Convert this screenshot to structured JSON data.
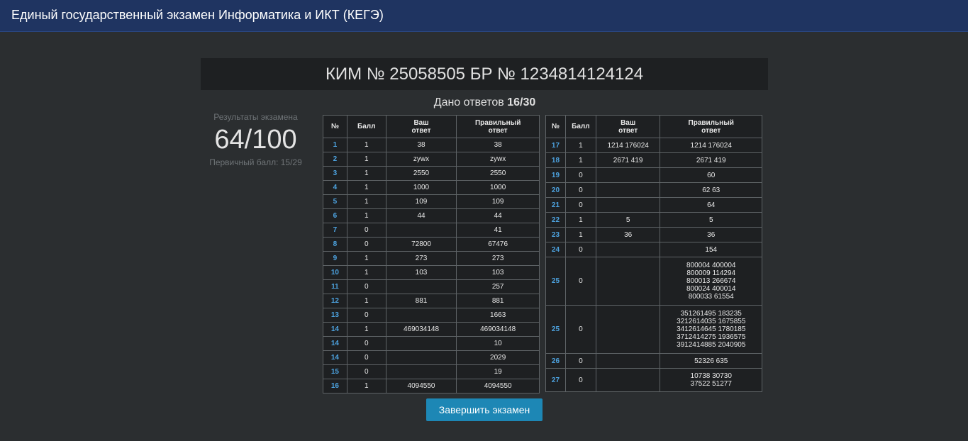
{
  "app": {
    "title": "Единый государственный экзамен Информатика и ИКТ (КЕГЭ)"
  },
  "header": {
    "kim_line": "КИМ № 25058505 БР № 1234814124124"
  },
  "answers_given": {
    "label": "Дано ответов",
    "value": "16/30"
  },
  "results": {
    "label": "Результаты экзамена",
    "score": "64/100",
    "primary": "Первичный балл: 15/29"
  },
  "table_headers": {
    "num": "№",
    "points": "Балл",
    "your_answer": "Ваш\nответ",
    "correct_answer": "Правильный\nответ"
  },
  "left_rows": [
    {
      "num": "1",
      "points": "1",
      "answer": "38",
      "correct": "38"
    },
    {
      "num": "2",
      "points": "1",
      "answer": "zywx",
      "correct": "zywx"
    },
    {
      "num": "3",
      "points": "1",
      "answer": "2550",
      "correct": "2550"
    },
    {
      "num": "4",
      "points": "1",
      "answer": "1000",
      "correct": "1000"
    },
    {
      "num": "5",
      "points": "1",
      "answer": "109",
      "correct": "109"
    },
    {
      "num": "6",
      "points": "1",
      "answer": "44",
      "correct": "44"
    },
    {
      "num": "7",
      "points": "0",
      "answer": "",
      "correct": "41"
    },
    {
      "num": "8",
      "points": "0",
      "answer": "72800",
      "correct": "67476"
    },
    {
      "num": "9",
      "points": "1",
      "answer": "273",
      "correct": "273"
    },
    {
      "num": "10",
      "points": "1",
      "answer": "103",
      "correct": "103"
    },
    {
      "num": "11",
      "points": "0",
      "answer": "",
      "correct": "257"
    },
    {
      "num": "12",
      "points": "1",
      "answer": "881",
      "correct": "881"
    },
    {
      "num": "13",
      "points": "0",
      "answer": "",
      "correct": "1663"
    },
    {
      "num": "14",
      "points": "1",
      "answer": "469034148",
      "correct": "469034148"
    },
    {
      "num": "14",
      "points": "0",
      "answer": "",
      "correct": "10"
    },
    {
      "num": "14",
      "points": "0",
      "answer": "",
      "correct": "2029"
    },
    {
      "num": "15",
      "points": "0",
      "answer": "",
      "correct": "19"
    },
    {
      "num": "16",
      "points": "1",
      "answer": "4094550",
      "correct": "4094550"
    }
  ],
  "right_rows": [
    {
      "num": "17",
      "points": "1",
      "answer": "1214 176024",
      "correct": "1214 176024"
    },
    {
      "num": "18",
      "points": "1",
      "answer": "2671 419",
      "correct": "2671 419"
    },
    {
      "num": "19",
      "points": "0",
      "answer": "",
      "correct": "60"
    },
    {
      "num": "20",
      "points": "0",
      "answer": "",
      "correct": "62 63"
    },
    {
      "num": "21",
      "points": "0",
      "answer": "",
      "correct": "64"
    },
    {
      "num": "22",
      "points": "1",
      "answer": "5",
      "correct": "5"
    },
    {
      "num": "23",
      "points": "1",
      "answer": "36",
      "correct": "36"
    },
    {
      "num": "24",
      "points": "0",
      "answer": "",
      "correct": "154"
    },
    {
      "num": "25",
      "points": "0",
      "answer": "",
      "correct": "800004 400004\n800009 114294\n800013 266674\n800024 400014\n800033 61554"
    },
    {
      "num": "25",
      "points": "0",
      "answer": "",
      "correct": "351261495 183235\n3212614035 1675855\n3412614645 1780185\n3712414275 1936575\n3912414885 2040905"
    },
    {
      "num": "26",
      "points": "0",
      "answer": "",
      "correct": "52326 635"
    },
    {
      "num": "27",
      "points": "0",
      "answer": "",
      "correct": "10738 30730\n37522 51277"
    }
  ],
  "actions": {
    "finish_label": "Завершить экзамен"
  }
}
